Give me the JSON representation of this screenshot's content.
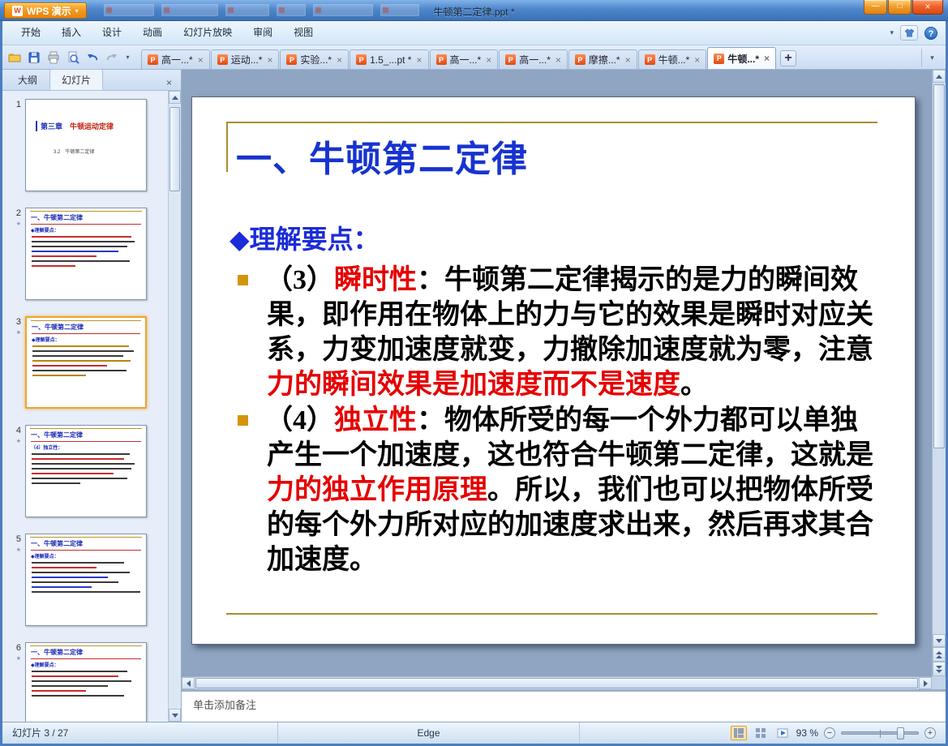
{
  "titlebar": {
    "app_button": "WPS 演示",
    "document_title": "牛顿第二定律.ppt *"
  },
  "menubar": {
    "items": [
      "开始",
      "插入",
      "设计",
      "动画",
      "幻灯片放映",
      "审阅",
      "视图"
    ]
  },
  "doc_tabs": [
    {
      "label": "高一...*"
    },
    {
      "label": "运动...*"
    },
    {
      "label": "实验...*"
    },
    {
      "label": "1.5_...pt *"
    },
    {
      "label": "高一...*"
    },
    {
      "label": "高一...*"
    },
    {
      "label": "摩擦...*"
    },
    {
      "label": "牛顿...*"
    },
    {
      "label": "牛顿...*"
    }
  ],
  "sidebar": {
    "outline_tab": "大纲",
    "slides_tab": "幻灯片",
    "thumbnails": [
      {
        "num": "1",
        "title_a": "第三章",
        "title_b": "　牛顿运动定律",
        "sub": "3.2　牛顿第二定律"
      },
      {
        "num": "2",
        "title": "一、牛顿第二定律",
        "lead": "◆理解要点："
      },
      {
        "num": "3",
        "title": "一、牛顿第二定律",
        "lead": "◆理解要点："
      },
      {
        "num": "4",
        "title": "一、牛顿第二定律",
        "lead": "（4）独立性："
      },
      {
        "num": "5",
        "title": "一、牛顿第二定律",
        "lead": "◆理解要点："
      },
      {
        "num": "6",
        "title": "一、牛顿第二定律",
        "lead": "◆理解要点："
      }
    ]
  },
  "slide": {
    "title": "一、牛顿第二定律",
    "heading": "◆理解要点：",
    "bullet3": {
      "lead": "（3）",
      "term": "瞬时性",
      "sep": "：",
      "body": "牛顿第二定律揭示的是力的瞬间效果，即作用在物体上的力与它的效果是瞬时对应关系，力变加速度就变，力撤除加速度就为零，注意",
      "red": "力的瞬间效果是加速度而不是速度",
      "end": "。"
    },
    "bullet4": {
      "lead": "（4）",
      "term": "独立性",
      "sep": "：",
      "body": "物体所受的每一个外力都可以单独产生一个加速度，这也符合牛顿第二定律，这就是",
      "red": "力的独立作用原理",
      "end": "。所以，我们也可以把物体所受的每个外力所对应的加速度求出来，然后再求其合加速度。"
    }
  },
  "notes": {
    "placeholder": "单击添加备注"
  },
  "statusbar": {
    "slide_indicator": "幻灯片 3 / 27",
    "theme_name": "Edge",
    "zoom_label": "93 %",
    "zoom_minus": "−",
    "zoom_plus": "+"
  },
  "icons": {
    "wps_logo": "W",
    "caret": "▾",
    "collapse": "▾",
    "help": "?",
    "min": "—",
    "max": "□",
    "close": "×",
    "file": "P",
    "tab_close": "×",
    "pane_close": "×",
    "plus": "+",
    "star": "★"
  },
  "colors": {
    "accent_orange": "#F59A23",
    "slide_title_blue": "#1733CF",
    "emphasis_red": "#E60000",
    "gold_rule": "#A88D2C",
    "bullet_gold": "#D4950A"
  }
}
